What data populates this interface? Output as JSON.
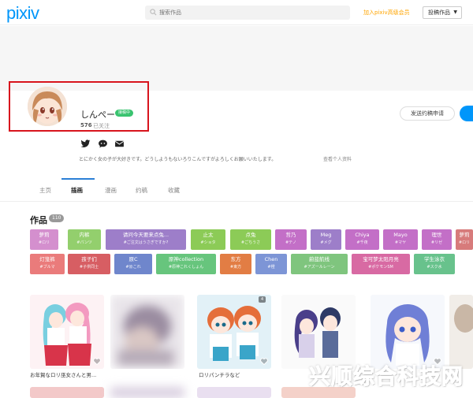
{
  "header": {
    "logo": "pixiv",
    "search_placeholder": "搜索作品",
    "premium_link": "加入pixiv高级会员",
    "post_button": "投稿作品",
    "colors": {
      "brand": "#0096fa",
      "premium": "#ffa500"
    }
  },
  "profile": {
    "username": "しんぺー",
    "status_badge": "接稿中",
    "following_count": "576",
    "following_label": "已关注",
    "message_button": "发送约稿申请",
    "bio": "とにかく女の子が大好きです。どうしようもないろりこんですがよろしくお願いいたします。",
    "bio_link": "查看个人资料",
    "social_icons": [
      "twitter-icon",
      "community-icon",
      "mail-icon"
    ],
    "highlight_color": "#d8141d"
  },
  "tabs": [
    {
      "label": "主页",
      "active": false
    },
    {
      "label": "插画",
      "active": true
    },
    {
      "label": "漫画",
      "active": false
    },
    {
      "label": "约稿",
      "active": false
    },
    {
      "label": "收藏",
      "active": false
    }
  ],
  "works": {
    "title": "作品",
    "count": "110"
  },
  "tags_row1": [
    {
      "name": "萝莉",
      "sub": "#ロリ",
      "color": "#d48fce"
    },
    {
      "name": "内裤",
      "sub": "#パンツ",
      "color": "#93cf6d"
    },
    {
      "name": "请问今天要来点兔...",
      "sub": "#ご注文はうさぎですか?",
      "color": "#9d7ec9"
    },
    {
      "name": "止太",
      "sub": "#ショタ",
      "color": "#8ccb57"
    },
    {
      "name": "点兔",
      "sub": "#ごちうさ",
      "color": "#8ccb57"
    },
    {
      "name": "哲乃",
      "sub": "#テノ",
      "color": "#c36fc7"
    },
    {
      "name": "Meg",
      "sub": "#メグ",
      "color": "#9d7ec9"
    },
    {
      "name": "Chiya",
      "sub": "#千夜",
      "color": "#c36fc7"
    },
    {
      "name": "Mayo",
      "sub": "#マヤ",
      "color": "#c36fc7"
    },
    {
      "name": "理世",
      "sub": "#リゼ",
      "color": "#c36fc7"
    },
    {
      "name": "萝莉",
      "sub": "#ロリ",
      "color": "#d77b7b"
    }
  ],
  "tags_row2": [
    {
      "name": "灯笼裤",
      "sub": "#ブルマ",
      "color": "#ea7b7b"
    },
    {
      "name": "孩子们",
      "sub": "#子供同士",
      "color": "#d75e63"
    },
    {
      "name": "原C",
      "sub": "#原これ",
      "color": "#6f86cc"
    },
    {
      "name": "原神collection",
      "sub": "#原神これくしょん",
      "color": "#67c57d"
    },
    {
      "name": "东方",
      "sub": "#東方",
      "color": "#e27d44"
    },
    {
      "name": "Chen",
      "sub": "#橙",
      "color": "#7d95d6"
    },
    {
      "name": "蔚蓝航线",
      "sub": "#アズールレーン",
      "color": "#7fc57e"
    },
    {
      "name": "宝可梦太阳月亮",
      "sub": "#ポケモンSM",
      "color": "#d86aa3"
    },
    {
      "name": "学生泳衣",
      "sub": "#スク水",
      "color": "#68c28c"
    }
  ],
  "thumbnails": [
    {
      "caption": "お年賀なロリ巫女さんと男...",
      "liked": false
    },
    {
      "caption": "",
      "liked": false
    },
    {
      "caption": "ロリパンチラなど",
      "liked": false,
      "count": "4"
    },
    {
      "caption": "",
      "liked": false
    },
    {
      "caption": "",
      "liked": false
    }
  ],
  "watermark": "兴顺综合科技网"
}
